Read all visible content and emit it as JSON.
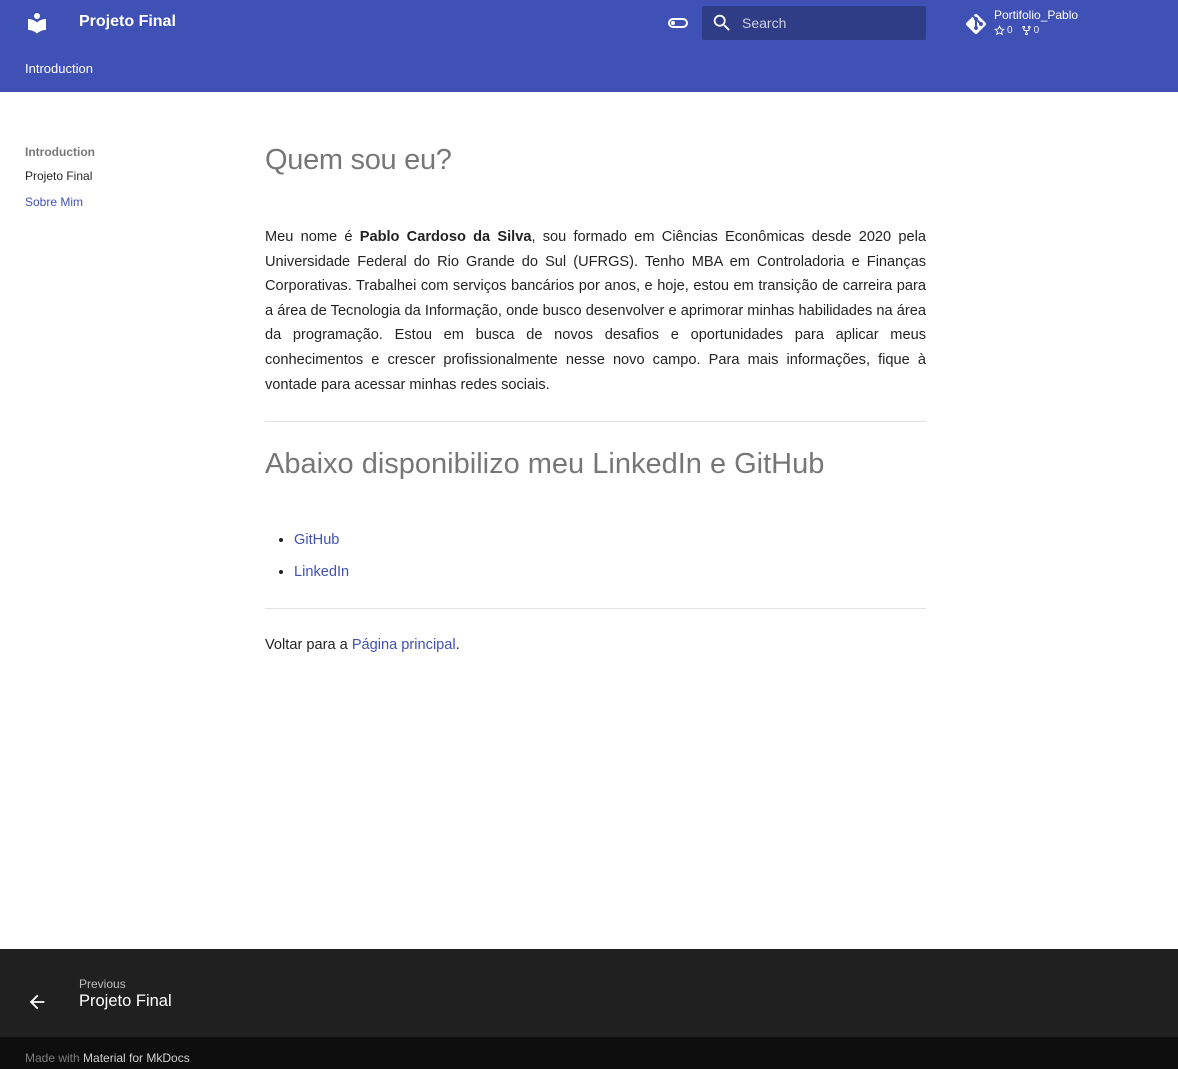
{
  "header": {
    "site_title": "Projeto Final",
    "search_placeholder": "Search",
    "repo": {
      "name": "Portifolio_Pablo",
      "stars": "0",
      "forks": "0"
    }
  },
  "tabs": [
    {
      "label": "Introduction"
    }
  ],
  "sidebar": {
    "section_title": "Introduction",
    "items": [
      {
        "label": "Projeto Final",
        "active": false
      },
      {
        "label": "Sobre Mim",
        "active": true
      }
    ]
  },
  "content": {
    "title": "Quem sou eu?",
    "intro_prefix": "Meu nome é ",
    "intro_name": "Pablo Cardoso da Silva",
    "intro_suffix": ", sou formado em Ciências Econômicas desde 2020 pela Universidade Federal do Rio Grande do Sul (UFRGS). Tenho MBA em Controladoria e Finanças Corporativas. Trabalhei com serviços bancários por anos, e hoje, estou em transição de carreira para a área de Tecnologia da Informação, onde busco desenvolver e aprimorar minhas habilidades na área da programação. Estou em busca de novos desafios e oportunidades para aplicar meus conhecimentos e crescer profissionalmente nesse novo campo. Para mais informações, fique à vontade para acessar minhas redes sociais.",
    "subtitle": "Abaixo disponibilizo meu LinkedIn e GitHub",
    "links": [
      {
        "label": "GitHub"
      },
      {
        "label": "LinkedIn"
      }
    ],
    "back_prefix": "Voltar para a ",
    "back_link": "Página principal",
    "back_suffix": "."
  },
  "footer": {
    "prev_direction": "Previous",
    "prev_title": "Projeto Final",
    "made_with_prefix": "Made with ",
    "made_with_link": "Material for MkDocs"
  },
  "colors": {
    "primary": "#4051b5",
    "footer": "#202020",
    "footer_meta": "#0e0e0e"
  },
  "icons": {
    "logo": "book-open-icon",
    "palette": "toggle-icon",
    "search": "search-icon",
    "repo": "git-icon",
    "stars": "star-icon",
    "forks": "fork-icon",
    "prev": "arrow-left-icon"
  }
}
